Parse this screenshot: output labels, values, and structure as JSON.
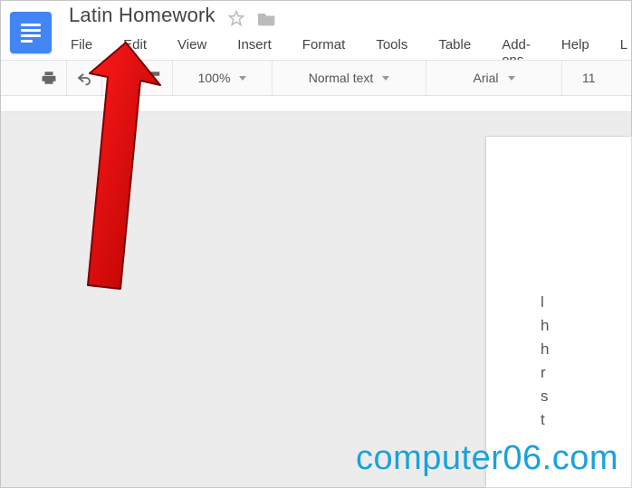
{
  "doc": {
    "title": "Latin Homework"
  },
  "menubar": [
    "File",
    "Edit",
    "View",
    "Insert",
    "Format",
    "Tools",
    "Table",
    "Add-ons",
    "Help",
    "L"
  ],
  "toolbar": {
    "zoom": "100%",
    "style": "Normal text",
    "font": "Arial",
    "fontsize": "11"
  },
  "page_lines": [
    "l",
    "h",
    "h",
    "r",
    "s",
    "t"
  ],
  "watermark": "computer06.com"
}
